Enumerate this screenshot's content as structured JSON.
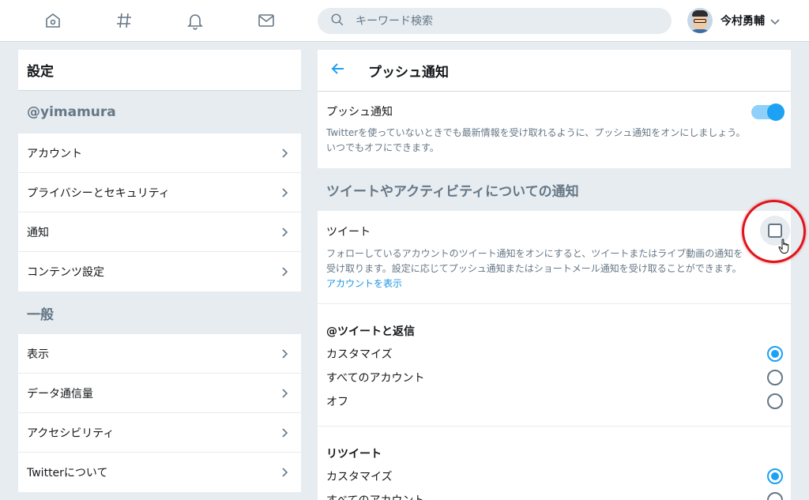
{
  "topbar": {
    "nav_icons": [
      "home-icon",
      "hashtag-icon",
      "bell-icon",
      "mail-icon"
    ],
    "search_placeholder": "キーワード検索",
    "user_name": "今村勇輔"
  },
  "sidebar": {
    "title": "設定",
    "account_handle": "@yimamura",
    "account_items": [
      "アカウント",
      "プライバシーとセキュリティ",
      "通知",
      "コンテンツ設定"
    ],
    "general_label": "一般",
    "general_items": [
      "表示",
      "データ通信量",
      "アクセシビリティ",
      "Twitterについて"
    ]
  },
  "main": {
    "title": "プッシュ通知",
    "push": {
      "label": "プッシュ通知",
      "enabled": true,
      "desc1": "Twitterを使っていないときでも最新情報を受け取れるように、プッシュ通知をオンにしましょう。",
      "desc2": "いつでもオフにできます。"
    },
    "section_heading": "ツイートやアクティビティについての通知",
    "tweet": {
      "label": "ツイート",
      "checked": false,
      "desc1": "フォローしているアカウントのツイート通知をオンにすると、ツイートまたはライブ動画の通知を",
      "desc2": "受け取ります。設定に応じてプッシュ通知またはショートメール通知を受け取ることができます。",
      "link": "アカウントを表示"
    },
    "mentions": {
      "title": "@ツイートと返信",
      "options": [
        "カスタマイズ",
        "すべてのアカウント",
        "オフ"
      ],
      "selected": 0
    },
    "retweets": {
      "title": "リツイート",
      "options": [
        "カスタマイズ",
        "すべてのアカウント"
      ],
      "selected": 0
    }
  },
  "colors": {
    "accent": "#1da1f2",
    "background": "#e6ecf0",
    "highlight": "#e0141b"
  }
}
